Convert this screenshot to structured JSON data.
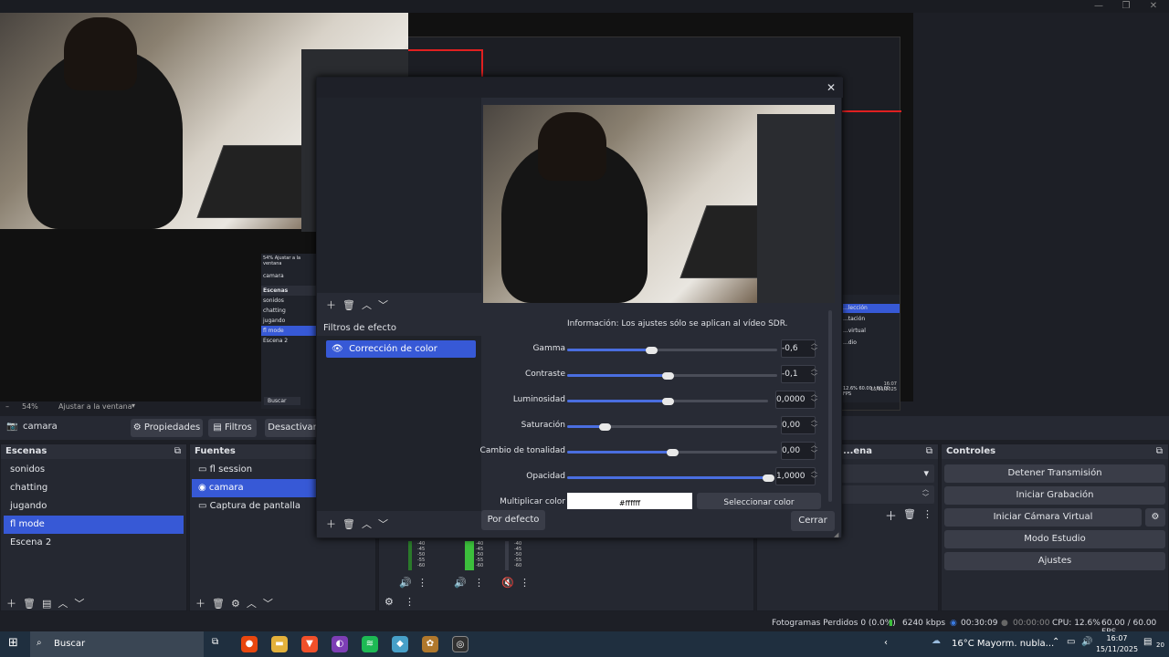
{
  "window": {
    "minimize": "—",
    "maximize": "❐",
    "close": "✕"
  },
  "preview": {
    "zoom": "54%",
    "fit": "Ajustar a la ventana"
  },
  "nested": {
    "scene_label": "camara",
    "scenes_header": "Escenas",
    "scenes": [
      "sonidos",
      "chatting",
      "jugando",
      "fl mode",
      "Escena 2"
    ],
    "search": "Buscar",
    "zoom": "54%",
    "fit": "Ajustar a la ventana",
    "status": "12.6%  60.00 / 60.00 FPS",
    "time": "16:07",
    "date": "15/11/2025",
    "menu_items": [
      "...lección",
      "...tación",
      "...virtual",
      "...dio"
    ]
  },
  "source_bar": {
    "name": "camara",
    "properties": "Propiedades",
    "filters": "Filtros",
    "deactivate": "Desactivar"
  },
  "scenes": {
    "title": "Escenas",
    "items": [
      "sonidos",
      "chatting",
      "jugando",
      "fl mode",
      "Escena 2"
    ],
    "selected": 3
  },
  "sources": {
    "title": "Fuentes",
    "items": [
      "fl session",
      "camara",
      "Captura de pantalla"
    ],
    "selected": 1
  },
  "transitions": {
    "title": "...ena"
  },
  "mixer": {
    "scale": [
      "-40",
      "-45",
      "-50",
      "-55",
      "-60"
    ]
  },
  "controls": {
    "title": "Controles",
    "stop_stream": "Detener Transmisión",
    "start_rec": "Iniciar Grabación",
    "virtual_cam": "Iniciar Cámara Virtual",
    "studio": "Modo Estudio",
    "settings": "Ajustes"
  },
  "dialog": {
    "effect_filters": "Filtros de efecto",
    "filter_item": "Corrección de color",
    "info": "Información: Los ajustes sólo se aplican al vídeo SDR.",
    "rows": [
      {
        "label": "Gamma",
        "value": "-0,6",
        "level": 0.4
      },
      {
        "label": "Contraste",
        "value": "-0,1",
        "level": 0.48
      },
      {
        "label": "Luminosidad",
        "value": "0,0000",
        "level": 0.5
      },
      {
        "label": "Saturación",
        "value": "0,00",
        "level": 0.18
      },
      {
        "label": "Cambio de tonalidad",
        "value": "0,00",
        "level": 0.5
      },
      {
        "label": "Opacidad",
        "value": "1,0000",
        "level": 1.0
      }
    ],
    "multiply_label": "Multiplicar color",
    "multiply_value": "#ffffff",
    "select_color": "Seleccionar color",
    "default_btn": "Por defecto",
    "close_btn": "Cerrar"
  },
  "status": {
    "dropped": "Fotogramas Perdidos 0 (0.0%)",
    "kbps": "6240 kbps",
    "stream_time": "00:30:09",
    "rec_time": "00:00:00",
    "cpu": "CPU: 12.6%",
    "fps": "60.00 / 60.00 FPS"
  },
  "taskbar": {
    "search": "Buscar",
    "weather": "16°C  Mayorm. nubla...",
    "time": "16:07",
    "date": "15/11/2025",
    "notif": "20"
  }
}
